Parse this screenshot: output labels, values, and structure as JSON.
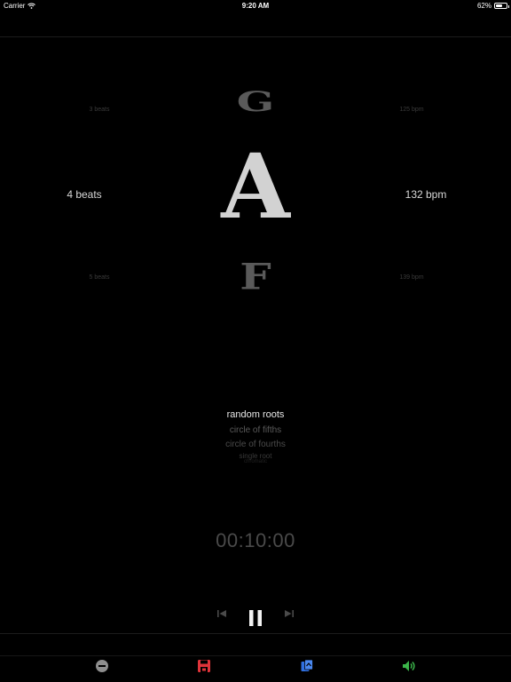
{
  "status_bar": {
    "carrier": "Carrier",
    "time": "9:20 AM",
    "battery": "62%",
    "battery_level": 0.62
  },
  "wheels": {
    "beats": {
      "above": "3 beats",
      "selected": "4 beats",
      "below": "5 beats"
    },
    "notes": {
      "above": "G",
      "selected": "A",
      "below": "F"
    },
    "bpm": {
      "above": "125 bpm",
      "selected": "132 bpm",
      "below": "139 bpm"
    }
  },
  "mode_picker": {
    "selected": "random roots",
    "options": [
      "circle of fifths",
      "circle of fourths",
      "single root",
      "chromatic"
    ]
  },
  "timer": "00:10:00",
  "transport": {
    "previous_icon": "skip-back-icon",
    "pause_icon": "pause-icon",
    "next_icon": "skip-forward-icon"
  },
  "tab_bar": {
    "items": [
      {
        "icon": "minus-circle-icon",
        "color": "#8e8e8e"
      },
      {
        "icon": "save-icon",
        "color": "#e0343a"
      },
      {
        "icon": "shuffle-icon",
        "color": "#2f6fe0"
      },
      {
        "icon": "speaker-icon",
        "color": "#3bb54a"
      }
    ]
  }
}
